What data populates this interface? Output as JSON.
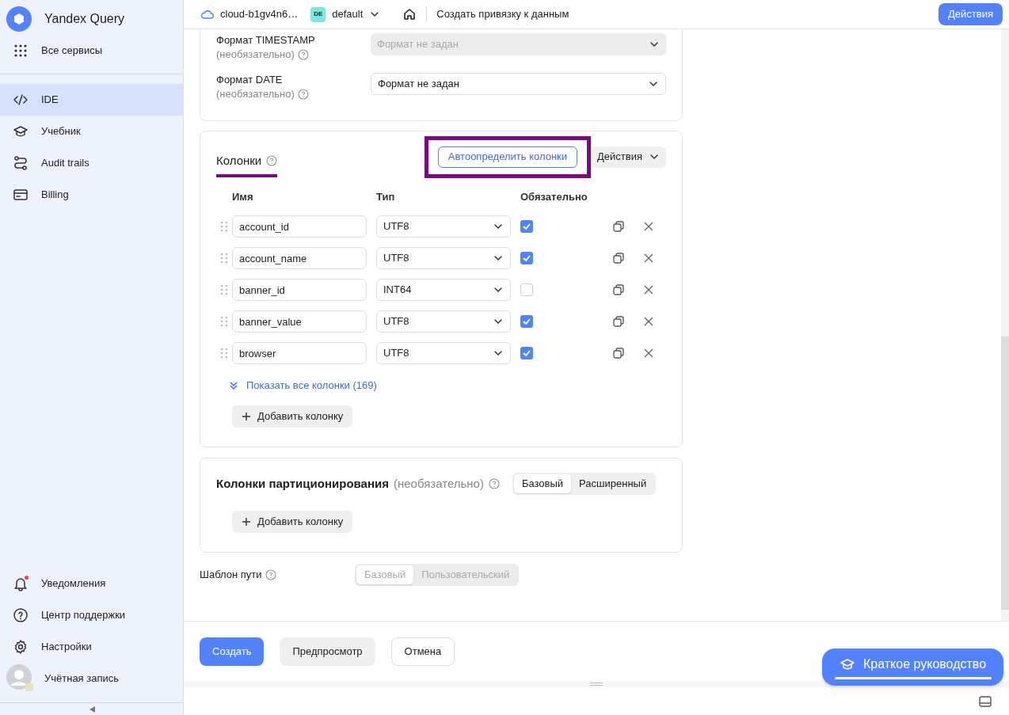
{
  "app": {
    "title": "Yandex Query"
  },
  "sidebar": {
    "services": "Все сервисы",
    "nav": [
      {
        "label": "IDE",
        "selected": true
      },
      {
        "label": "Учебник",
        "selected": false
      },
      {
        "label": "Audit trails",
        "selected": false
      },
      {
        "label": "Billing",
        "selected": false
      }
    ],
    "bottom": [
      {
        "label": "Уведомления",
        "unread": true
      },
      {
        "label": "Центр поддержки",
        "unread": false
      },
      {
        "label": "Настройки",
        "unread": false
      },
      {
        "label": "Учётная запись",
        "unread": false
      }
    ]
  },
  "header": {
    "cloud": "cloud-b1gv4n6…",
    "folder_badge": "DE",
    "folder": "default",
    "breadcrumb": "Создать привязку к данным",
    "action_button": "Действия"
  },
  "format_rows": [
    {
      "label": "Формат TIMESTAMP",
      "hint": "(необязательно)",
      "value": "Формат не задан",
      "disabled": true
    },
    {
      "label": "Формат DATE",
      "hint": "(необязательно)",
      "value": "Формат не задан",
      "disabled": false
    }
  ],
  "columns": {
    "title": "Колонки",
    "autodetect_button": "Автоопределить колонки",
    "actions_button": "Действия",
    "headers": [
      "Имя",
      "Тип",
      "Обязательно"
    ],
    "rows": [
      {
        "name": "account_id",
        "type": "UTF8",
        "required": true
      },
      {
        "name": "account_name",
        "type": "UTF8",
        "required": true
      },
      {
        "name": "banner_id",
        "type": "INT64",
        "required": false
      },
      {
        "name": "banner_value",
        "type": "UTF8",
        "required": true
      },
      {
        "name": "browser",
        "type": "UTF8",
        "required": true
      }
    ],
    "show_all": "Показать все колонки (169)",
    "add_button": "Добавить колонку"
  },
  "partition": {
    "title": "Колонки партиционирования",
    "optional": "(необязательно)",
    "modes": [
      {
        "label": "Базовый",
        "selected": true
      },
      {
        "label": "Расширенный",
        "selected": false
      }
    ],
    "add_button": "Добавить колонку"
  },
  "path_template": {
    "label": "Шаблон пути",
    "disabled": true,
    "modes": [
      {
        "label": "Базовый",
        "selected": true
      },
      {
        "label": "Пользовательский",
        "selected": false
      }
    ]
  },
  "footer": [
    {
      "label": "Создать",
      "kind": "primary"
    },
    {
      "label": "Предпросмотр",
      "kind": "secondary"
    },
    {
      "label": "Отмена",
      "kind": "outline"
    }
  ],
  "guide_button": "Краткое руководство"
}
